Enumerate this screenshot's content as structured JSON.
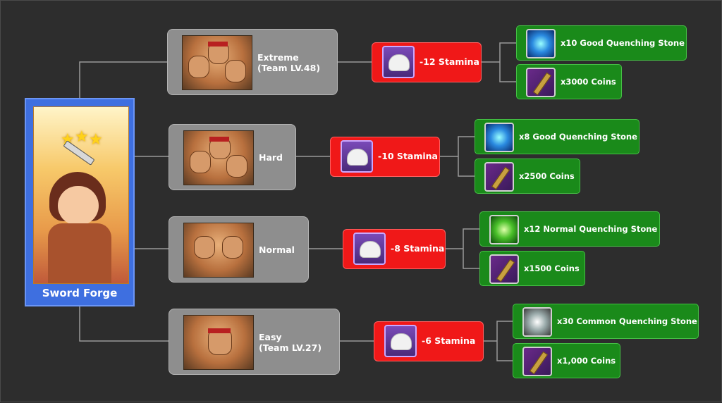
{
  "root": {
    "title": "Sword Forge",
    "icon": "sword-forge-hero-art"
  },
  "difficulties": [
    {
      "label_line1": "Extreme",
      "label_line2": "(Team LV.48)",
      "stamina": "-12 Stamina",
      "rewards": [
        {
          "text": "x10 Good Quenching Stone",
          "icon": "good-quenching-stone-icon"
        },
        {
          "text": "x3000 Coins",
          "icon": "coins-icon"
        }
      ]
    },
    {
      "label_line1": "Hard",
      "label_line2": "",
      "stamina": "-10 Stamina",
      "rewards": [
        {
          "text": "x8 Good Quenching Stone",
          "icon": "good-quenching-stone-icon"
        },
        {
          "text": "x2500 Coins",
          "icon": "coins-icon"
        }
      ]
    },
    {
      "label_line1": "Normal",
      "label_line2": "",
      "stamina": "-8 Stamina",
      "rewards": [
        {
          "text": "x12 Normal Quenching Stone",
          "icon": "normal-quenching-stone-icon"
        },
        {
          "text": "x1500 Coins",
          "icon": "coins-icon"
        }
      ]
    },
    {
      "label_line1": "Easy",
      "label_line2": "(Team LV.27)",
      "stamina": "-6 Stamina",
      "rewards": [
        {
          "text": "x30 Common Quenching Stone",
          "icon": "common-quenching-stone-icon"
        },
        {
          "text": "x1,000 Coins",
          "icon": "coins-icon"
        }
      ]
    }
  ],
  "colors": {
    "background": "#2d2d2d",
    "root": "#3e6fe0",
    "difficulty": "#8e8e8e",
    "stamina": "#f01818",
    "reward": "#1a8a1a",
    "connector": "#9a9a9a"
  }
}
